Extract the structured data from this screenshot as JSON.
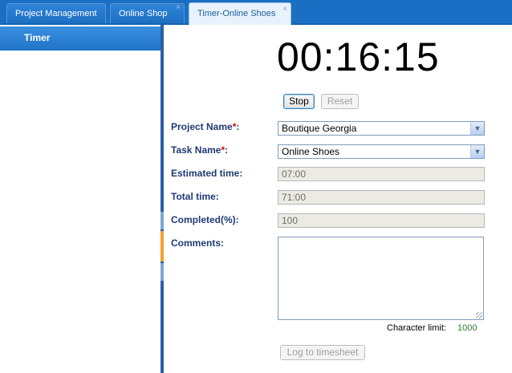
{
  "tabs": [
    {
      "label": "Project Management"
    },
    {
      "label": "Online Shop",
      "close": "×"
    },
    {
      "label": "Timer-Online Shoes",
      "close": "×"
    }
  ],
  "sidebar": {
    "items": [
      {
        "label": "Timer"
      }
    ]
  },
  "timer": {
    "display": "00:16:15"
  },
  "buttons": {
    "stop": "Stop",
    "reset": "Reset",
    "log": "Log to timesheet"
  },
  "form": {
    "project_name": {
      "label": "Project Name",
      "required": "*",
      "suffix": ":",
      "value": "Boutique Georgia"
    },
    "task_name": {
      "label": "Task Name",
      "required": "*",
      "suffix": ":",
      "value": "Online Shoes"
    },
    "estimated_time": {
      "label": "Estimated time:",
      "value": "07:00"
    },
    "total_time": {
      "label": "Total time:",
      "value": "71:00"
    },
    "completed": {
      "label": "Completed(%):",
      "value": "100"
    },
    "comments": {
      "label": "Comments:",
      "value": ""
    }
  },
  "char_limit": {
    "label": "Character limit:",
    "value": "1000"
  },
  "colors": {
    "tabbar": "#1a6fc4",
    "sidebar_active": "#1f74c9",
    "label": "#1f3a73",
    "required": "#d00000"
  }
}
